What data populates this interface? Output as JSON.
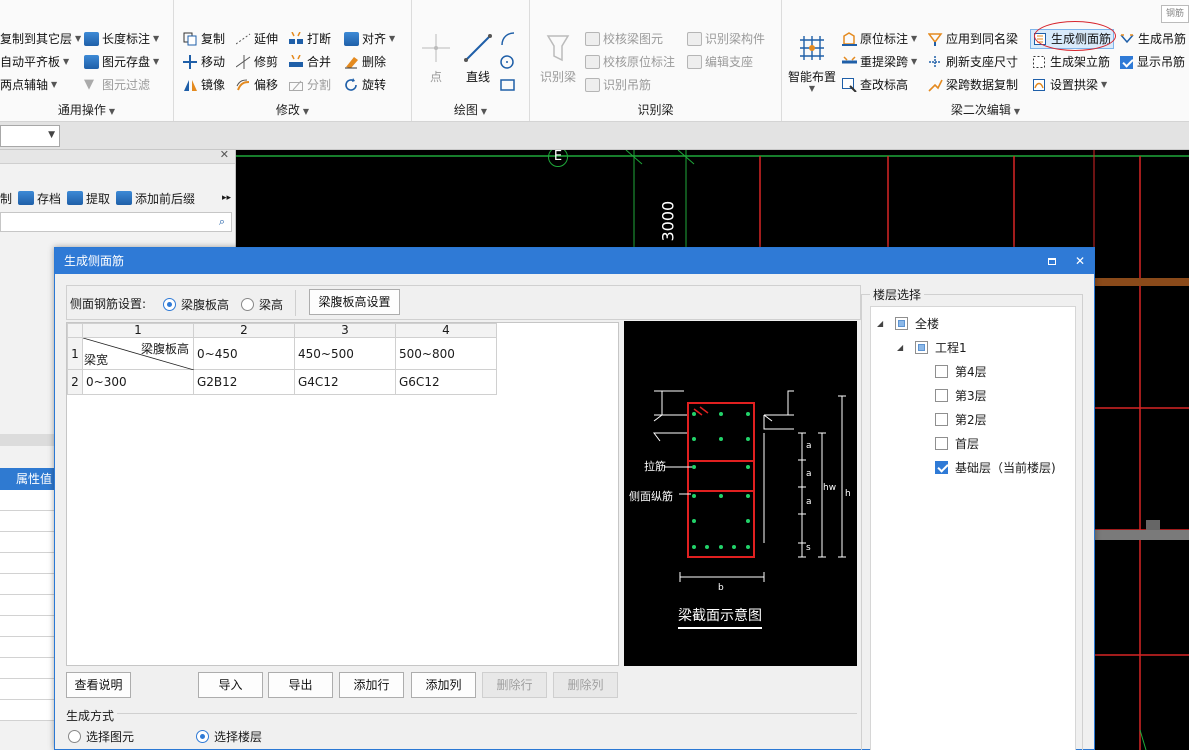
{
  "ribbon": {
    "tag_top_right": "钢筋",
    "general": {
      "items": [
        "复制到其它层",
        "自动平齐板",
        "两点辅轴"
      ],
      "col2": [
        "长度标注",
        "图元存盘",
        "图元过滤"
      ],
      "label": "通用操作"
    },
    "modify": {
      "col1": [
        "复制",
        "移动",
        "镜像"
      ],
      "col2": [
        "延伸",
        "修剪",
        "偏移"
      ],
      "col3": [
        "打断",
        "合并",
        "分割"
      ],
      "col4": [
        "对齐",
        "删除",
        "旋转"
      ],
      "label": "修改"
    },
    "draw": {
      "point": "点",
      "line": "直线",
      "label": "绘图"
    },
    "recognize": {
      "big": "识别梁",
      "col1": [
        "校核梁图元",
        "校核原位标注",
        "识别吊筋"
      ],
      "col2": [
        "识别梁构件",
        "编辑支座"
      ],
      "label": "识别梁"
    },
    "secondary": {
      "big": "智能布置",
      "col1": [
        "原位标注",
        "重提梁跨",
        "查改标高"
      ],
      "col2": [
        "应用到同名梁",
        "刷新支座尺寸",
        "梁跨数据复制"
      ],
      "col3": [
        "生成侧面筋",
        "生成架立筋",
        "设置拱梁"
      ],
      "col4": [
        "生成吊筋",
        "显示吊筋"
      ],
      "label": "梁二次编辑"
    }
  },
  "left_panel": {
    "tools": [
      "制",
      "存档",
      "提取",
      "添加前后缀"
    ],
    "prop_header": "属性值"
  },
  "cad": {
    "axis_label": "E",
    "dimension": "3000"
  },
  "dialog": {
    "title": "生成侧面筋",
    "settings_label": "侧面钢筋设置:",
    "radio_web": "梁腹板高",
    "radio_height": "梁高",
    "web_height_button": "梁腹板高设置",
    "grid": {
      "col_headers": [
        "1",
        "2",
        "3",
        "4"
      ],
      "row_headers": [
        "1",
        "2"
      ],
      "corner_top": "梁腹板高",
      "corner_bottom": "梁宽",
      "header_row": [
        "0~450",
        "450~500",
        "500~800"
      ],
      "data_row": [
        "0~300",
        "G2B12",
        "G4C12",
        "G6C12"
      ]
    },
    "preview": {
      "caption": "梁截面示意图",
      "label_tie": "拉筋",
      "label_side": "侧面纵筋",
      "dim_a": "a",
      "dim_hw": "hw",
      "dim_h": "h",
      "dim_s": "s",
      "dim_b": "b"
    },
    "buttons": {
      "help": "查看说明",
      "import": "导入",
      "export": "导出",
      "add_row": "添加行",
      "add_col": "添加列",
      "del_row": "删除行",
      "del_col": "删除列"
    },
    "floor": {
      "legend": "楼层选择",
      "all": "全楼",
      "project": "工程1",
      "floors": [
        "第4层",
        "第3层",
        "第2层",
        "首层",
        "基础层（当前楼层)"
      ]
    },
    "method": {
      "legend": "生成方式",
      "opt_element": "选择图元",
      "opt_floor": "选择楼层"
    }
  }
}
